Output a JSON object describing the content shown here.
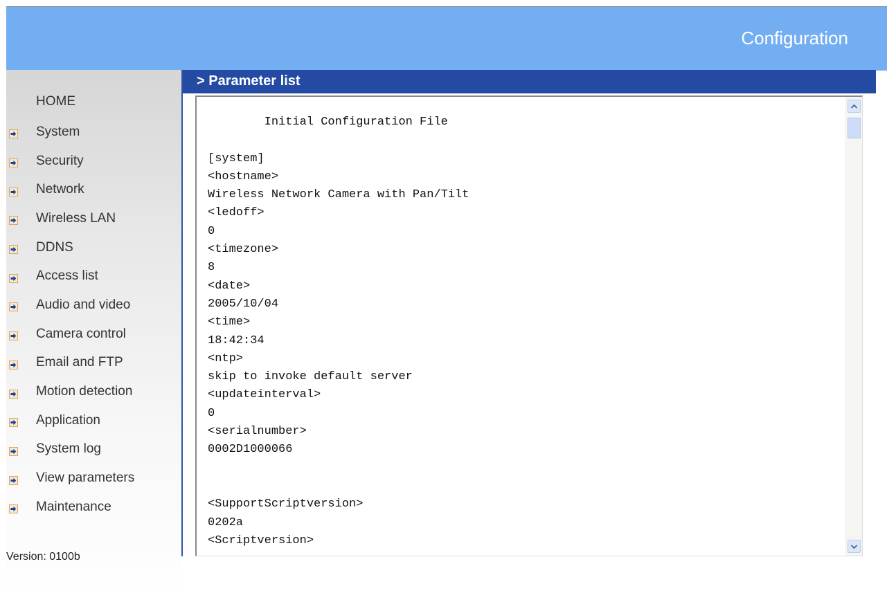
{
  "header": {
    "title": "Configuration",
    "background": "#74aef2"
  },
  "sidebar": {
    "home": "HOME",
    "items": [
      {
        "label": "System"
      },
      {
        "label": "Security"
      },
      {
        "label": "Network"
      },
      {
        "label": "Wireless LAN"
      },
      {
        "label": "DDNS"
      },
      {
        "label": "Access list"
      },
      {
        "label": "Audio and video"
      },
      {
        "label": "Camera control"
      },
      {
        "label": "Email and FTP"
      },
      {
        "label": "Motion detection"
      },
      {
        "label": "Application"
      },
      {
        "label": "System log"
      },
      {
        "label": "View parameters"
      },
      {
        "label": "Maintenance"
      }
    ],
    "item_icon": "arrow-bullet-icon",
    "version": "Version: 0100b"
  },
  "panel": {
    "title": "> Parameter list",
    "header_color": "#244aa3",
    "content": "        Initial Configuration File\n\n[system]\n<hostname>\nWireless Network Camera with Pan/Tilt\n<ledoff>\n0\n<timezone>\n8\n<date>\n2005/10/04\n<time>\n18:42:34\n<ntp>\nskip to invoke default server\n<updateinterval>\n0\n<serialnumber>\n0002D1000066\n\n\n<SupportScriptversion>\n0202a\n<Scriptversion>"
  },
  "scrollbar": {
    "up_icon": "chevron-up-icon",
    "down_icon": "chevron-down-icon"
  }
}
